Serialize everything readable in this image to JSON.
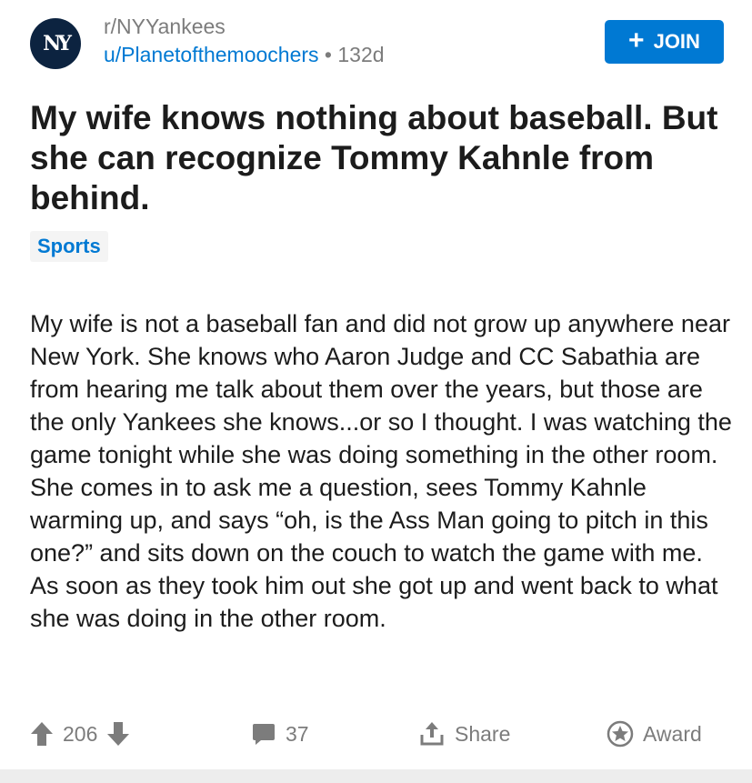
{
  "header": {
    "subreddit": "r/NYYankees",
    "user": "u/Planetofthemoochers",
    "separator": " • ",
    "age": "132d",
    "avatar_text": "NY",
    "join_label": "JOIN"
  },
  "post": {
    "title": "My wife knows nothing about baseball. But she can recognize Tommy Kahnle from behind.",
    "flair": "Sports",
    "body": "My wife is not a baseball fan and did not grow up anywhere near New York. She knows who Aaron Judge and CC Sabathia are from hearing me talk about them over the years, but those are the only Yankees she knows...or so I thought. I was watching the game tonight while she was doing something in the other room. She comes in to ask me a question, sees Tommy Kahnle warming up, and says “oh, is the Ass Man going to pitch in this one?”  and sits down on the couch to watch the game with me. As soon as they took him out she got up and went back to what she was doing in the other room."
  },
  "actions": {
    "score": "206",
    "comments": "37",
    "share_label": "Share",
    "award_label": "Award"
  },
  "colors": {
    "accent": "#0079d3",
    "muted": "#7c7c7c",
    "text": "#1c1c1c",
    "avatar_bg": "#0c2340"
  },
  "icons": [
    "upvote-icon",
    "downvote-icon",
    "comment-icon",
    "share-icon",
    "award-icon",
    "plus-icon"
  ]
}
